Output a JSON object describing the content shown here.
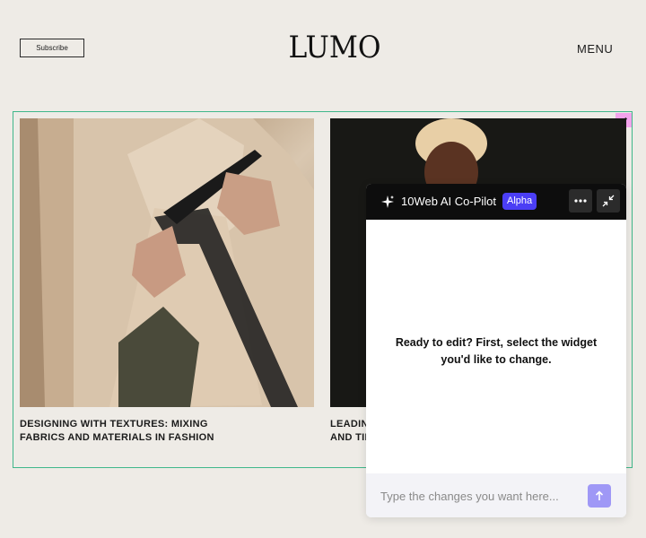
{
  "header": {
    "subscribe_label": "Subscribe",
    "logo_text": "LUMO",
    "menu_label": "MENU"
  },
  "cards": [
    {
      "title": "DESIGNING WITH TEXTURES: MIXING FABRICS AND MATERIALS IN FASHION",
      "image": "tailor-fitting-jacket-photo"
    },
    {
      "title": "LEADIN AND TIP",
      "image": "model-portrait-photo"
    }
  ],
  "copilot": {
    "title": "10Web AI Co-Pilot",
    "badge": "Alpha",
    "message": "Ready to edit? First, select the widget you'd like to change.",
    "input_placeholder": "Type the changes you want here...",
    "icons": [
      "sparkle-icon",
      "more-icon",
      "collapse-icon",
      "send-arrow-icon"
    ]
  },
  "colors": {
    "background": "#eeebe6",
    "frame": "#3fb78a",
    "edit_badge": "#f3a3ec",
    "copilot_header": "#0d0d0d",
    "alpha_badge": "#4b3ef5",
    "send_button": "#9f98f6"
  }
}
